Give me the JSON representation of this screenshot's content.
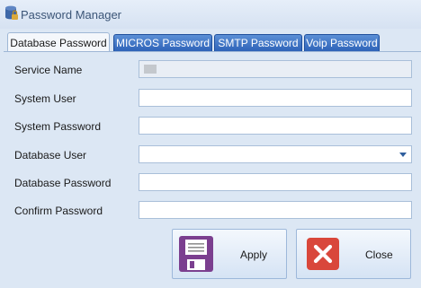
{
  "window": {
    "title": "Password Manager"
  },
  "tabs": [
    {
      "label": "Database Password",
      "active": true
    },
    {
      "label": "MICROS Password",
      "active": false
    },
    {
      "label": "SMTP Password",
      "active": false
    },
    {
      "label": "Voip Password",
      "active": false
    }
  ],
  "form": {
    "service_name": {
      "label": "Service Name",
      "value": ""
    },
    "system_user": {
      "label": "System User",
      "value": ""
    },
    "system_password": {
      "label": "System Password",
      "value": ""
    },
    "database_user": {
      "label": "Database User",
      "value": ""
    },
    "database_password": {
      "label": "Database Password",
      "value": ""
    },
    "confirm_password": {
      "label": "Confirm Password",
      "value": ""
    }
  },
  "buttons": {
    "apply": {
      "label": "Apply",
      "icon": "save-icon"
    },
    "close": {
      "label": "Close",
      "icon": "close-icon"
    }
  },
  "colors": {
    "tab_blue": "#2e63b8",
    "save_icon": "#7b3f8f",
    "close_icon": "#d9473b"
  }
}
